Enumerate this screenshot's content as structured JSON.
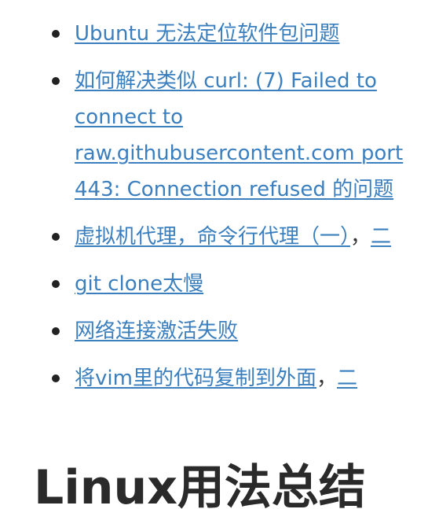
{
  "links": [
    {
      "text": "Ubuntu 无法定位软件包问题"
    },
    {
      "text": "如何解决类似 curl: (7) Failed to connect to raw.githubusercontent.com port 443: Connection refused 的问题"
    },
    {
      "text": "虚拟机代理，命令行代理（一）",
      "separator": "，",
      "extra": "二"
    },
    {
      "text": "git clone太慢"
    },
    {
      "text": "网络连接激活失败"
    },
    {
      "text": "将vim里的代码复制到外面",
      "separator": "，",
      "extra": "二"
    }
  ],
  "heading": "Linux用法总结"
}
